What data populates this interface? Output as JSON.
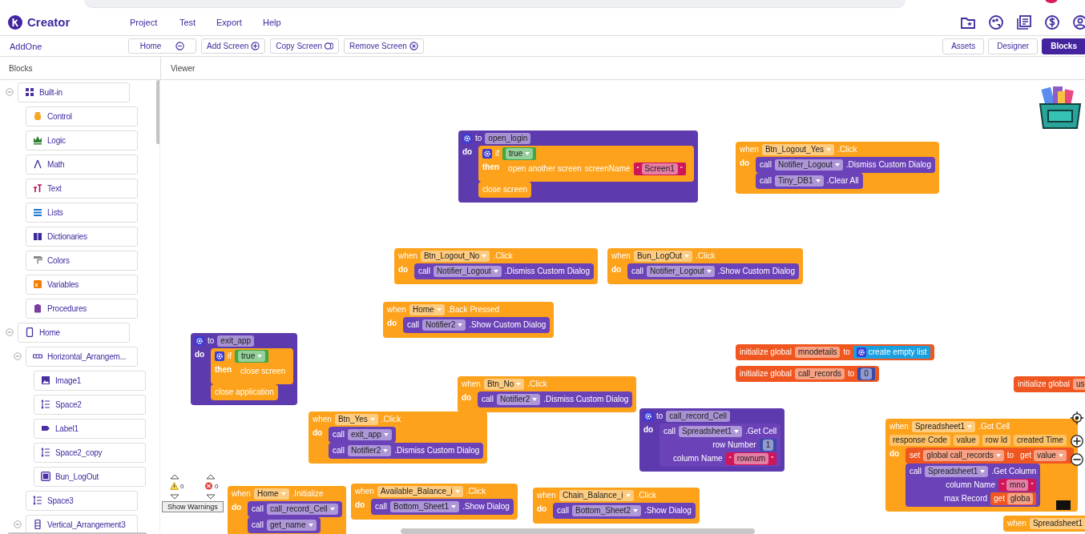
{
  "app": {
    "name": "Creator"
  },
  "menu": [
    "Project",
    "Test",
    "Export",
    "Help"
  ],
  "header_icons": [
    {
      "kind": "folder"
    },
    {
      "kind": "palette"
    },
    {
      "kind": "document"
    },
    {
      "kind": "dollar"
    },
    {
      "kind": "user"
    }
  ],
  "toolbar": {
    "project": "AddOne",
    "screen": "Home",
    "actions": [
      {
        "kind": "add",
        "label": "Add Screen"
      },
      {
        "kind": "copy",
        "label": "Copy Screen"
      },
      {
        "kind": "remove",
        "label": "Remove Screen"
      }
    ]
  },
  "views": [
    {
      "label": "Assets",
      "selected": false
    },
    {
      "label": "Designer",
      "selected": false
    },
    {
      "label": "Blocks",
      "selected": true
    }
  ],
  "panels": {
    "blocks": "Blocks",
    "viewer": "Viewer"
  },
  "tree": [
    {
      "label": "Built-in",
      "kind": "builtin",
      "expanded": true,
      "children": [
        {
          "label": "Control",
          "kind": "control"
        },
        {
          "label": "Logic",
          "kind": "logic"
        },
        {
          "label": "Math",
          "kind": "math"
        },
        {
          "label": "Text",
          "kind": "text"
        },
        {
          "label": "Lists",
          "kind": "lists"
        },
        {
          "label": "Dictionaries",
          "kind": "dictionaries"
        },
        {
          "label": "Colors",
          "kind": "colors"
        },
        {
          "label": "Variables",
          "kind": "variables"
        },
        {
          "label": "Procedures",
          "kind": "procedures"
        }
      ]
    },
    {
      "label": "Home",
      "kind": "screen",
      "expanded": true,
      "children": [
        {
          "label": "Horizontal_Arrangem...",
          "kind": "horizontal",
          "expanded": true,
          "children": [
            {
              "label": "Image1",
              "kind": "image"
            },
            {
              "label": "Space2",
              "kind": "space"
            },
            {
              "label": "Label1",
              "kind": "label"
            },
            {
              "label": "Space2_copy",
              "kind": "space"
            },
            {
              "label": "Bun_LogOut",
              "kind": "button"
            }
          ]
        },
        {
          "label": "Space3",
          "kind": "space"
        },
        {
          "label": "Vertical_Arrangement3",
          "kind": "vertical",
          "expanded": true
        }
      ]
    }
  ],
  "canvas": {
    "blocks": [
      {
        "kind": "procedure",
        "lines": [
          [
            {
              "kind": "mutator"
            },
            {
              "kind": "word",
              "text": "to"
            },
            {
              "kind": "field",
              "text": "open_login"
            }
          ]
        ],
        "body_label": "do",
        "body": [
          {
            "kind": "control",
            "lines": [
              [
                {
                  "kind": "mutator"
                },
                {
                  "kind": "word",
                  "text": "if"
                },
                {
                  "kind": "boolean",
                  "text": "true"
                }
              ]
            ],
            "body_label": "then",
            "body": [
              {
                "kind": "control",
                "lines": [
                  [
                    {
                      "kind": "word",
                      "text": "open another screen"
                    },
                    {
                      "kind": "word",
                      "text": "screenName"
                    },
                    {
                      "kind": "string",
                      "open": "“",
                      "text": "Screen1",
                      "close": "”"
                    }
                  ]
                ]
              }
            ]
          },
          {
            "kind": "control",
            "lines": [
              [
                {
                  "kind": "word",
                  "text": "close screen"
                }
              ]
            ]
          }
        ]
      },
      {
        "kind": "event",
        "lines": [
          [
            {
              "kind": "word",
              "text": "when"
            },
            {
              "kind": "dropdown",
              "text": "Btn_Logout_Yes"
            },
            {
              "kind": "word",
              "text": ".Click"
            }
          ]
        ],
        "body_label": "do",
        "body": [
          {
            "kind": "call",
            "lines": [
              [
                {
                  "kind": "word",
                  "text": "call"
                },
                {
                  "kind": "dropdown",
                  "text": "Notifier_Logout"
                },
                {
                  "kind": "word",
                  "text": ".Dismiss Custom Dialog"
                }
              ]
            ]
          },
          {
            "kind": "call",
            "lines": [
              [
                {
                  "kind": "word",
                  "text": "call"
                },
                {
                  "kind": "dropdown",
                  "text": "Tiny_DB1"
                },
                {
                  "kind": "word",
                  "text": ".Clear All"
                }
              ]
            ]
          }
        ]
      },
      {
        "kind": "event",
        "lines": [
          [
            {
              "kind": "word",
              "text": "when"
            },
            {
              "kind": "dropdown",
              "text": "Btn_Logout_No"
            },
            {
              "kind": "word",
              "text": ".Click"
            }
          ]
        ],
        "body_label": "do",
        "body": [
          {
            "kind": "call",
            "lines": [
              [
                {
                  "kind": "word",
                  "text": "call"
                },
                {
                  "kind": "dropdown",
                  "text": "Notifier_Logout"
                },
                {
                  "kind": "word",
                  "text": ".Dismiss Custom Dialog"
                }
              ]
            ]
          }
        ]
      },
      {
        "kind": "event",
        "lines": [
          [
            {
              "kind": "word",
              "text": "when"
            },
            {
              "kind": "dropdown",
              "text": "Bun_LogOut"
            },
            {
              "kind": "word",
              "text": ".Click"
            }
          ]
        ],
        "body_label": "do",
        "body": [
          {
            "kind": "call",
            "lines": [
              [
                {
                  "kind": "word",
                  "text": "call"
                },
                {
                  "kind": "dropdown",
                  "text": "Notifier_Logout"
                },
                {
                  "kind": "word",
                  "text": ".Show Custom Dialog"
                }
              ]
            ]
          }
        ]
      },
      {
        "kind": "event",
        "lines": [
          [
            {
              "kind": "word",
              "text": "when"
            },
            {
              "kind": "dropdown",
              "text": "Home"
            },
            {
              "kind": "word",
              "text": ".Back Pressed"
            }
          ]
        ],
        "body_label": "do",
        "body": [
          {
            "kind": "call",
            "lines": [
              [
                {
                  "kind": "word",
                  "text": "call"
                },
                {
                  "kind": "dropdown",
                  "text": "Notifier2"
                },
                {
                  "kind": "word",
                  "text": ".Show Custom Dialog"
                }
              ]
            ]
          }
        ]
      },
      {
        "kind": "procedure",
        "lines": [
          [
            {
              "kind": "mutator"
            },
            {
              "kind": "word",
              "text": "to"
            },
            {
              "kind": "field",
              "text": "exit_app"
            }
          ]
        ],
        "body_label": "do",
        "body": [
          {
            "kind": "control",
            "lines": [
              [
                {
                  "kind": "mutator"
                },
                {
                  "kind": "word",
                  "text": "if"
                },
                {
                  "kind": "boolean",
                  "text": "true"
                }
              ]
            ],
            "body_label": "then",
            "body": [
              {
                "kind": "control",
                "lines": [
                  [
                    {
                      "kind": "word",
                      "text": "close screen"
                    }
                  ]
                ]
              }
            ]
          },
          {
            "kind": "control",
            "lines": [
              [
                {
                  "kind": "word",
                  "text": "close application"
                }
              ]
            ]
          }
        ]
      },
      {
        "kind": "global",
        "lines": [
          [
            {
              "kind": "word",
              "text": "initialize global"
            },
            {
              "kind": "field",
              "text": "mnodetails"
            },
            {
              "kind": "word",
              "text": "to"
            },
            {
              "kind": "list",
              "tokens": [
                {
                  "kind": "mutator"
                },
                {
                  "kind": "word",
                  "text": "create empty list"
                }
              ]
            }
          ]
        ]
      },
      {
        "kind": "global",
        "lines": [
          [
            {
              "kind": "word",
              "text": "initialize global"
            },
            {
              "kind": "field",
              "text": "call_records"
            },
            {
              "kind": "word",
              "text": "to"
            },
            {
              "kind": "number",
              "text": "0"
            }
          ]
        ]
      },
      {
        "kind": "event",
        "lines": [
          [
            {
              "kind": "word",
              "text": "when"
            },
            {
              "kind": "dropdown",
              "text": "Btn_No"
            },
            {
              "kind": "word",
              "text": ".Click"
            }
          ]
        ],
        "body_label": "do",
        "body": [
          {
            "kind": "call",
            "lines": [
              [
                {
                  "kind": "word",
                  "text": "call"
                },
                {
                  "kind": "dropdown",
                  "text": "Notifier2"
                },
                {
                  "kind": "word",
                  "text": ".Dismiss Custom Dialog"
                }
              ]
            ]
          }
        ]
      },
      {
        "kind": "global",
        "lines": [
          [
            {
              "kind": "word",
              "text": "initialize global"
            },
            {
              "kind": "field",
              "text": "us"
            }
          ]
        ]
      },
      {
        "kind": "event",
        "lines": [
          [
            {
              "kind": "word",
              "text": "when"
            },
            {
              "kind": "dropdown",
              "text": "Btn_Yes"
            },
            {
              "kind": "word",
              "text": ".Click"
            }
          ]
        ],
        "body_label": "do",
        "body": [
          {
            "kind": "call",
            "lines": [
              [
                {
                  "kind": "word",
                  "text": "call"
                },
                {
                  "kind": "dropdown",
                  "text": "exit_app"
                }
              ]
            ]
          },
          {
            "kind": "call",
            "lines": [
              [
                {
                  "kind": "word",
                  "text": "call"
                },
                {
                  "kind": "dropdown",
                  "text": "Notifier2"
                },
                {
                  "kind": "word",
                  "text": ".Dismiss Custom Dialog"
                }
              ]
            ]
          }
        ]
      },
      {
        "kind": "procedure",
        "lines": [
          [
            {
              "kind": "mutator"
            },
            {
              "kind": "word",
              "text": "to"
            },
            {
              "kind": "field",
              "text": "call_record_Cell"
            }
          ]
        ],
        "body_label": "do",
        "body": [
          {
            "kind": "call",
            "lines": [
              [
                {
                  "kind": "word",
                  "text": "call"
                },
                {
                  "kind": "dropdown",
                  "text": "Spreadsheet1"
                },
                {
                  "kind": "word",
                  "text": ".Get Cell"
                }
              ],
              [
                {
                  "kind": "word",
                  "text": "row Number"
                },
                {
                  "kind": "number",
                  "text": "1"
                }
              ],
              [
                {
                  "kind": "word",
                  "text": "column Name"
                },
                {
                  "kind": "string",
                  "open": "“",
                  "text": "rownum",
                  "close": "”"
                }
              ]
            ]
          }
        ]
      },
      {
        "kind": "event",
        "lines": [
          [
            {
              "kind": "word",
              "text": "when"
            },
            {
              "kind": "dropdown",
              "text": "Spreadsheet1"
            },
            {
              "kind": "word",
              "text": ".Got Cell"
            }
          ],
          [
            {
              "kind": "param",
              "text": "response Code"
            },
            {
              "kind": "param",
              "text": "value"
            },
            {
              "kind": "param",
              "text": "row Id"
            },
            {
              "kind": "param",
              "text": "created Time"
            }
          ]
        ],
        "body_label": "do",
        "body": [
          {
            "kind": "setter",
            "lines": [
              [
                {
                  "kind": "word",
                  "text": "set"
                },
                {
                  "kind": "dropdown",
                  "text": "global call_records"
                },
                {
                  "kind": "word",
                  "text": "to"
                },
                {
                  "kind": "getter",
                  "tokens": [
                    {
                      "kind": "word",
                      "text": "get"
                    },
                    {
                      "kind": "dropdown",
                      "text": "value"
                    }
                  ]
                }
              ]
            ]
          },
          {
            "kind": "call",
            "lines": [
              [
                {
                  "kind": "word",
                  "text": "call"
                },
                {
                  "kind": "dropdown",
                  "text": "Spreadsheet1"
                },
                {
                  "kind": "word",
                  "text": ".Get Column"
                }
              ],
              [
                {
                  "kind": "word",
                  "text": "column Name"
                },
                {
                  "kind": "string",
                  "open": "“",
                  "text": "mno",
                  "close": "”"
                }
              ],
              [
                {
                  "kind": "word",
                  "text": "max Record"
                },
                {
                  "kind": "getter",
                  "tokens": [
                    {
                      "kind": "word",
                      "text": "get"
                    },
                    {
                      "kind": "field",
                      "text": "globa"
                    }
                  ]
                }
              ]
            ]
          }
        ]
      },
      {
        "kind": "event",
        "lines": [
          [
            {
              "kind": "word",
              "text": "when"
            },
            {
              "kind": "dropdown",
              "text": "Home"
            },
            {
              "kind": "word",
              "text": ".Initialize"
            }
          ]
        ],
        "body_label": "do",
        "body": [
          {
            "kind": "call",
            "lines": [
              [
                {
                  "kind": "word",
                  "text": "call"
                },
                {
                  "kind": "dropdown",
                  "text": "call_record_Cell"
                }
              ]
            ]
          },
          {
            "kind": "call",
            "lines": [
              [
                {
                  "kind": "word",
                  "text": "call"
                },
                {
                  "kind": "dropdown",
                  "text": "get_name"
                }
              ]
            ]
          }
        ]
      },
      {
        "kind": "event",
        "lines": [
          [
            {
              "kind": "word",
              "text": "when"
            },
            {
              "kind": "dropdown",
              "text": "Available_Balance_i"
            },
            {
              "kind": "word",
              "text": ".Click"
            }
          ]
        ],
        "body_label": "do",
        "body": [
          {
            "kind": "call",
            "lines": [
              [
                {
                  "kind": "word",
                  "text": "call"
                },
                {
                  "kind": "dropdown",
                  "text": "Bottom_Sheet1"
                },
                {
                  "kind": "word",
                  "text": ".Show Dialog"
                }
              ]
            ]
          }
        ]
      },
      {
        "kind": "event",
        "lines": [
          [
            {
              "kind": "word",
              "text": "when"
            },
            {
              "kind": "dropdown",
              "text": "Chain_Balance_i"
            },
            {
              "kind": "word",
              "text": ".Click"
            }
          ]
        ],
        "body_label": "do",
        "body": [
          {
            "kind": "call",
            "lines": [
              [
                {
                  "kind": "word",
                  "text": "call"
                },
                {
                  "kind": "dropdown",
                  "text": "Bottom_Sheet2"
                },
                {
                  "kind": "word",
                  "text": ".Show Dialog"
                }
              ]
            ]
          }
        ]
      },
      {
        "kind": "event",
        "lines": [
          [
            {
              "kind": "word",
              "text": "when"
            },
            {
              "kind": "dropdown",
              "text": "Spreadsheet1"
            }
          ]
        ]
      }
    ],
    "warnings": {
      "warning_count": "0",
      "error_count": "0",
      "button": "Show Warnings"
    }
  }
}
